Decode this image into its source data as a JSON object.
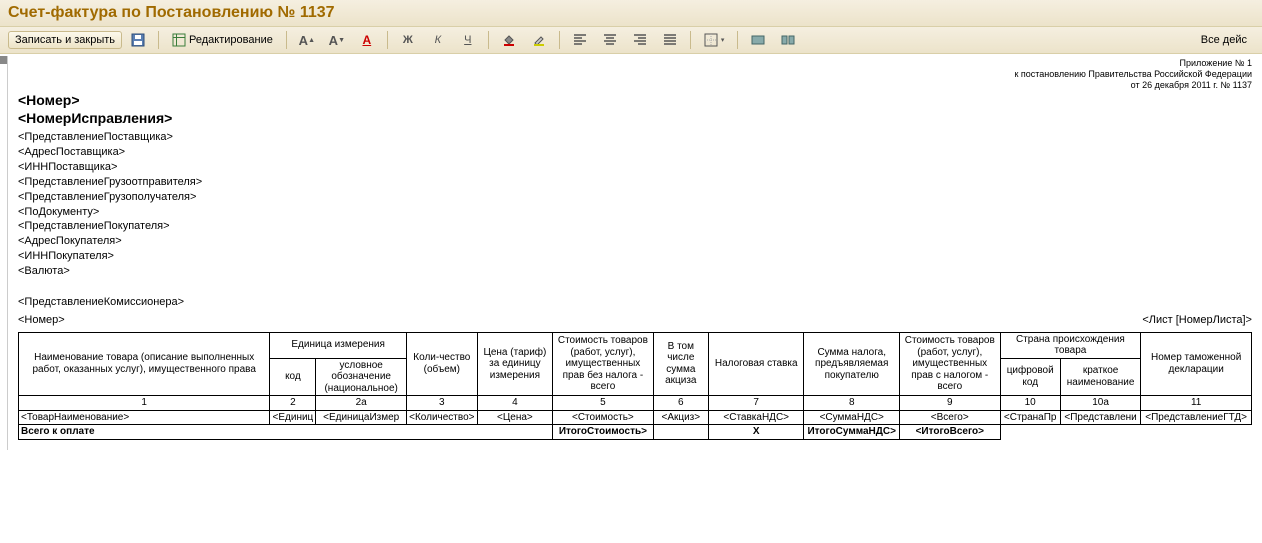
{
  "title": "Счет-фактура по Постановлению № 1137",
  "toolbar": {
    "save_close": "Записать и закрыть",
    "edit": "Редактирование",
    "all_actions": "Все дейс"
  },
  "doc": {
    "appendix_line1": "Приложение № 1",
    "appendix_line2": "к постановлению Правительства Российской Федерации",
    "appendix_line3": "от 26 декабря 2011 г. № 1137",
    "ph_number": "<Номер>",
    "ph_corr_number": "<НомерИсправления>",
    "fields": [
      "<ПредставлениеПоставщика>",
      "<АдресПоставщика>",
      "<ИННПоставщика>",
      "<ПредставлениеГрузоотправителя>",
      "<ПредставлениеГрузополучателя>",
      "<ПоДокументу>",
      "<ПредставлениеПокупателя>",
      "<АдресПокупателя>",
      "<ИННПокупателя>",
      "<Валюта>"
    ],
    "commissioner": "<ПредставлениеКомиссионера>",
    "sheet_number_left": "<Номер>",
    "sheet_label_right": "<Лист [НомерЛиста]>"
  },
  "table": {
    "headers": {
      "h1": "Наименование товара (описание выполненных работ, оказанных услуг), имущественного права",
      "h2_group": "Единица измерения",
      "h2_code": "код",
      "h2_name": "условное обозначение (национальное)",
      "h3": "Коли-чество (объем)",
      "h4": "Цена (тариф) за единицу измерения",
      "h5": "Стоимость товаров (работ, услуг), имущественных прав без налога - всего",
      "h6": "В том числе сумма акциза",
      "h7": "Налоговая ставка",
      "h8": "Сумма налога, предъявляемая покупателю",
      "h9": "Стоимость товаров (работ, услуг), имущественных прав с налогом - всего",
      "h10_group": "Страна происхождения товара",
      "h10_code": "цифровой код",
      "h10_name": "краткое наименование",
      "h11": "Номер таможенной декларации"
    },
    "colnums": [
      "1",
      "2",
      "2а",
      "3",
      "4",
      "5",
      "6",
      "7",
      "8",
      "9",
      "10",
      "10а",
      "11"
    ],
    "row": {
      "c1": "<ТоварНаименование>",
      "c2": "<Единиц",
      "c2a": "<ЕдиницаИзмер",
      "c3": "<Количество>",
      "c4": "<Цена>",
      "c5": "<Стоимость>",
      "c6": "<Акциз>",
      "c7": "<СтавкаНДС>",
      "c8": "<СуммаНДС>",
      "c9": "<Всего>",
      "c10": "<СтранаПр",
      "c10a": "<Представлени",
      "c11": "<ПредставлениеГТД>"
    },
    "total": {
      "label": "Всего к оплате",
      "c5": "ИтогоСтоимость>",
      "c6": "",
      "c7": "Х",
      "c8": "ИтогоСуммаНДС>",
      "c9": "<ИтогоВсего>"
    }
  }
}
